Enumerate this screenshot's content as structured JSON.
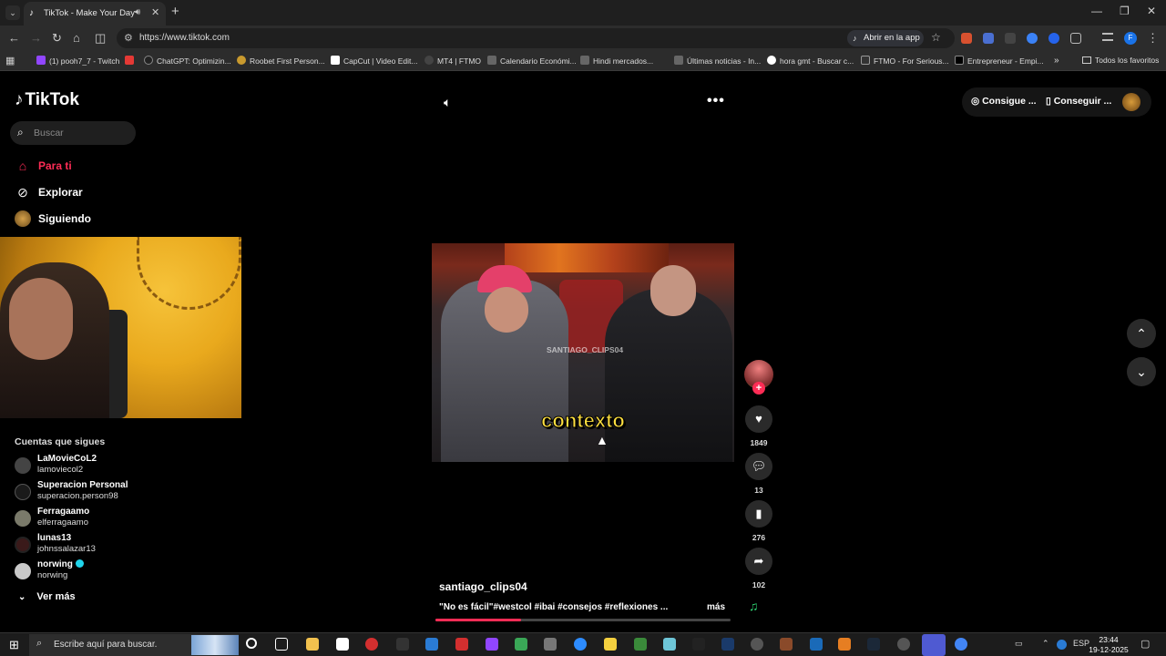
{
  "browser": {
    "tab_title": "TikTok - Make Your Day",
    "url": "https://www.tiktok.com",
    "open_in_app": "Abrir en la app",
    "bookmarks": [
      "(1) pooh7_7 - Twitch",
      "ChatGPT: Optimizin...",
      "Roobet First Person...",
      "CapCut | Video Edit...",
      "MT4 | FTMO",
      "Calendario Económi...",
      "Hindi mercados...",
      "Últimas noticias - In...",
      "hora gmt - Buscar c...",
      "FTMO - For Serious...",
      "Entrepreneur - Empi..."
    ],
    "all_favorites": "Todos los favoritos",
    "profile_initial": "F"
  },
  "tiktok": {
    "logo": "TikTok",
    "search_placeholder": "Buscar",
    "nav": [
      {
        "label": "Para ti",
        "icon": "home-icon",
        "active": true
      },
      {
        "label": "Explorar",
        "icon": "compass-icon",
        "active": false
      },
      {
        "label": "Siguiendo",
        "icon": "following-avatar-icon",
        "active": false
      }
    ],
    "following_title": "Cuentas que sigues",
    "accounts": [
      {
        "name": "LaMovieCoL2",
        "handle": "lamoviecol2",
        "color": "#444444",
        "verified": false
      },
      {
        "name": "Superacion Personal",
        "handle": "superacion.person98",
        "color": "#1a1a1a",
        "verified": false
      },
      {
        "name": "Ferragaamo",
        "handle": "elferragaamo",
        "color": "#7a7a6a",
        "verified": false
      },
      {
        "name": "lunas13",
        "handle": "johnssalazar13",
        "color": "#3a1a1a",
        "verified": false
      },
      {
        "name": "norwing",
        "handle": "norwing",
        "color": "#c9c9c9",
        "verified": true
      }
    ],
    "see_more": "Ver más",
    "top_buttons": [
      "Consigue ...",
      "Conseguir ..."
    ],
    "video": {
      "watermark": "SANTIAGO_CLIPS04",
      "caption": "contexto",
      "author": "santiago_clips04",
      "description": "\"No es fácil\"#westcol #ibai #consejos #reflexiones ...",
      "more_label": "más",
      "progress": 0.29
    },
    "counts": {
      "likes": "1849",
      "comments": "13",
      "saves": "276",
      "shares": "102"
    }
  },
  "taskbar": {
    "search_placeholder": "Escribe aquí para buscar.",
    "lang": "ESP",
    "time": "23:44",
    "date": "19-12-2025"
  }
}
